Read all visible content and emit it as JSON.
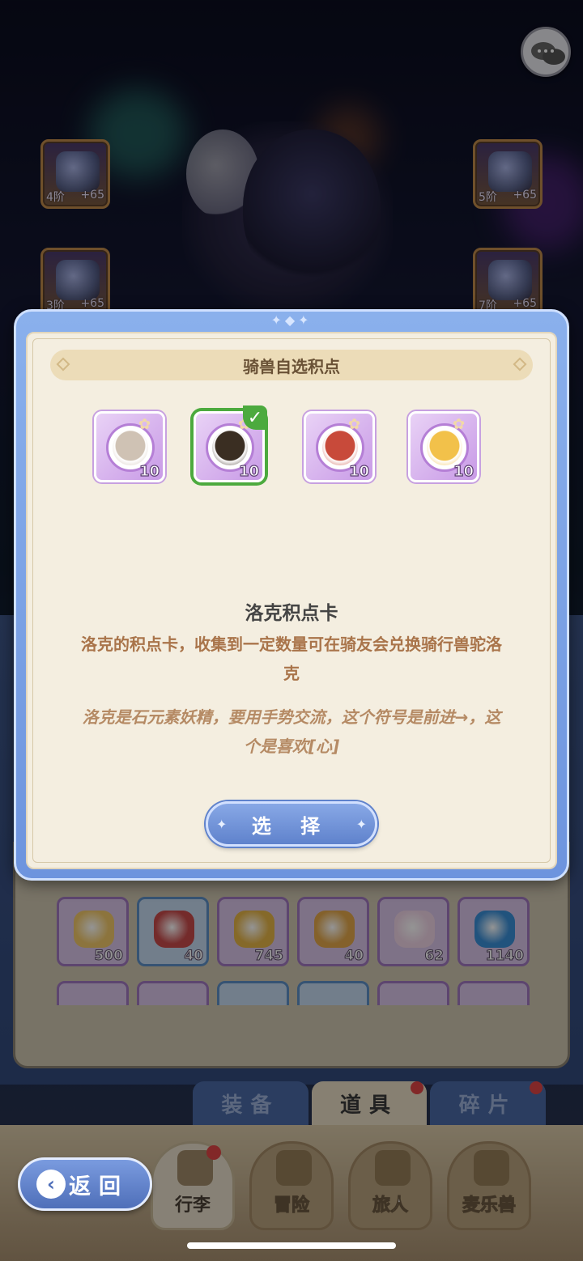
{
  "equipment": {
    "weapon": {
      "label": "4阶",
      "bonus": "+65"
    },
    "helmet": {
      "label": "5阶",
      "bonus": "+65"
    },
    "armor": {
      "label": "3阶",
      "bonus": "+65"
    },
    "boots": {
      "label": "7阶",
      "bonus": "+65"
    }
  },
  "dialog": {
    "title": "骑兽自选积点",
    "options": [
      {
        "count": "10",
        "selected": false,
        "color": "#cfc2b4"
      },
      {
        "count": "10",
        "selected": true,
        "color": "#3a2e22"
      },
      {
        "count": "10",
        "selected": false,
        "color": "#c84a3a"
      },
      {
        "count": "10",
        "selected": false,
        "color": "#f2c14a"
      }
    ],
    "item_name": "洛克积点卡",
    "item_desc": "洛克的积点卡，收集到一定数量可在骑友会兑换骑行兽驼洛克",
    "item_flavor": "洛克是石元素妖精，要用手势交流，这个符号是前进→，这个是喜欢[心]",
    "select_label": "选 择"
  },
  "bag": {
    "items": [
      {
        "count": "500",
        "border": "purple",
        "color": "#f2c96a"
      },
      {
        "count": "40",
        "border": "blue",
        "color": "#c84a4a"
      },
      {
        "count": "745",
        "border": "purple",
        "color": "#e6b548"
      },
      {
        "count": "40",
        "border": "purple",
        "color": "#e3a74a"
      },
      {
        "count": "62",
        "border": "purple",
        "color": "#f0d4e6"
      },
      {
        "count": "1140",
        "border": "purple",
        "color": "#3a8fd8"
      }
    ]
  },
  "tabs": [
    {
      "label": "装备",
      "active": false,
      "badge": false
    },
    {
      "label": "道具",
      "active": true,
      "badge": true
    },
    {
      "label": "碎片",
      "active": false,
      "badge": true
    }
  ],
  "nav": {
    "back": "返回",
    "items": [
      {
        "label": "行李",
        "active": true,
        "badge": true
      },
      {
        "label": "冒险",
        "active": false,
        "badge": false
      },
      {
        "label": "旅人",
        "active": false,
        "badge": false
      },
      {
        "label": "麦乐兽",
        "active": false,
        "badge": false
      }
    ]
  },
  "colors": {
    "accent_blue": "#6d94de",
    "selected_green": "#4caa3e",
    "badge_red": "#e04545"
  }
}
